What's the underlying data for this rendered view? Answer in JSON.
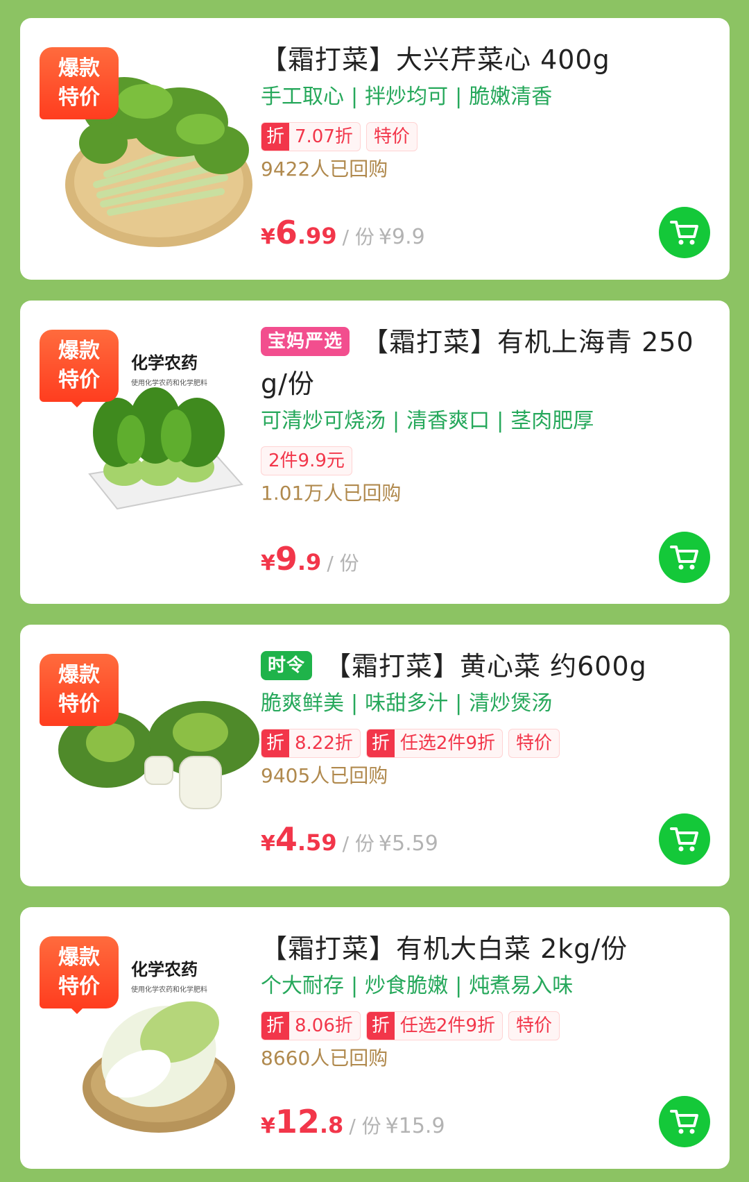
{
  "products": [
    {
      "badge": [
        "爆款",
        "特价"
      ],
      "pre_tag": "",
      "title": "【霜打菜】大兴芹菜心 400g",
      "features": [
        "手工取心",
        "拌炒均可",
        "脆嫩清香"
      ],
      "promos": [
        {
          "prefix": "折",
          "text": "7.07折"
        },
        {
          "prefix": "",
          "text": "特价"
        }
      ],
      "rebuy": "9422人已回购",
      "price_yen": "¥",
      "price_int": "6",
      "price_dec": ".99",
      "price_unit": "/ 份",
      "price_orig": "¥9.9",
      "image": "celery-hearts"
    },
    {
      "badge": [
        "爆款",
        "特价"
      ],
      "pre_tag": "宝妈严选",
      "title": "【霜打菜】有机上海青 250 g/份",
      "features": [
        "可清炒可烧汤",
        "清香爽口",
        "茎肉肥厚"
      ],
      "promos": [
        {
          "prefix": "",
          "text": "2件9.9元"
        }
      ],
      "rebuy": "1.01万人已回购",
      "price_yen": "¥",
      "price_int": "9",
      "price_dec": ".9",
      "price_unit": "/ 份",
      "price_orig": "",
      "image_text": "化学农药",
      "image_subtext": "使用化学农药和化学肥料",
      "image": "shanghai-bok-choy"
    },
    {
      "badge": [
        "爆款",
        "特价"
      ],
      "pre_tag": "时令",
      "title": "【霜打菜】黄心菜 约600g",
      "features": [
        "脆爽鲜美",
        "味甜多汁",
        "清炒煲汤"
      ],
      "promos": [
        {
          "prefix": "折",
          "text": "8.22折"
        },
        {
          "prefix": "折",
          "text": "任选2件9折"
        },
        {
          "prefix": "",
          "text": "特价"
        }
      ],
      "rebuy": "9405人已回购",
      "price_yen": "¥",
      "price_int": "4",
      "price_dec": ".59",
      "price_unit": "/ 份",
      "price_orig": "¥5.59",
      "image": "yellow-heart-cabbage"
    },
    {
      "badge": [
        "爆款",
        "特价"
      ],
      "pre_tag": "",
      "title": "【霜打菜】有机大白菜 2kg/份",
      "features": [
        "个大耐存",
        "炒食脆嫩",
        "炖煮易入味"
      ],
      "promos": [
        {
          "prefix": "折",
          "text": "8.06折"
        },
        {
          "prefix": "折",
          "text": "任选2件9折"
        },
        {
          "prefix": "",
          "text": "特价"
        }
      ],
      "rebuy": "8660人已回购",
      "price_yen": "¥",
      "price_int": "12",
      "price_dec": ".8",
      "price_unit": "/ 份",
      "price_orig": "¥15.9",
      "image_text": "化学农药",
      "image_subtext": "使用化学农药和化学肥料",
      "image": "napa-cabbage"
    }
  ],
  "colors": {
    "background": "#8cc363",
    "price_red": "#f2364a",
    "feature_green": "#26a85b",
    "cart_green": "#14c839",
    "rebuy_gold": "#b0894d"
  },
  "icons": {
    "cart": "shopping-cart-icon"
  }
}
